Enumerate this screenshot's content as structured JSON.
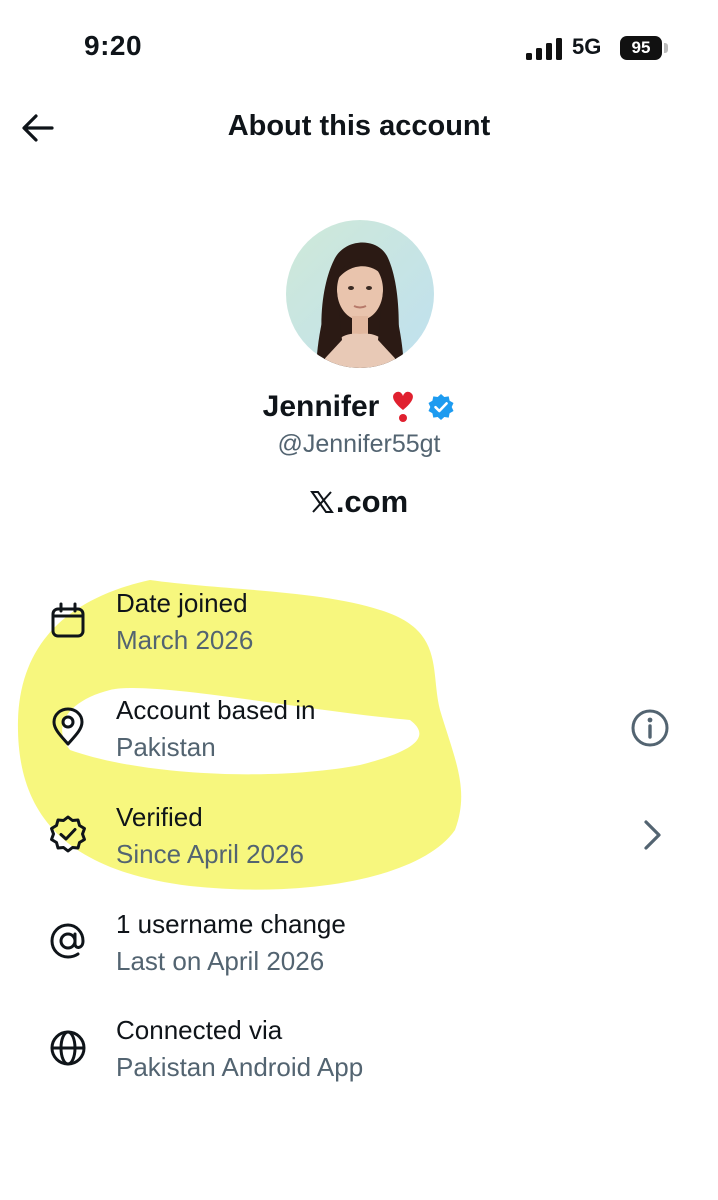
{
  "status_bar": {
    "time": "9:20",
    "network": "5G",
    "battery": "95"
  },
  "header": {
    "title": "About this account",
    "back_icon": "arrow-left-icon"
  },
  "profile": {
    "name": "Jennifer",
    "emoji": "❣️",
    "verified_badge": "verified-badge-icon",
    "handle": "@Jennifer55gt",
    "site_text": ".com",
    "site_logo": "x-logo-icon"
  },
  "rows": [
    {
      "icon": "calendar-icon",
      "title": "Date joined",
      "subtitle": "March 2026",
      "trailing": null
    },
    {
      "icon": "location-pin-icon",
      "title": "Account based in",
      "subtitle": "Pakistan",
      "trailing": "info-icon"
    },
    {
      "icon": "verified-check-icon",
      "title": "Verified",
      "subtitle": "Since April 2026",
      "trailing": "chevron-right-icon"
    },
    {
      "icon": "at-sign-icon",
      "title": "1 username change",
      "subtitle": "Last on April 2026",
      "trailing": null
    },
    {
      "icon": "globe-icon",
      "title": "Connected via",
      "subtitle": "Pakistan Android App",
      "trailing": null
    }
  ],
  "colors": {
    "primary_text": "#0f1419",
    "secondary_text": "#536471",
    "verified_blue": "#1d9bf0",
    "highlighter_yellow": "#f5f55a"
  }
}
